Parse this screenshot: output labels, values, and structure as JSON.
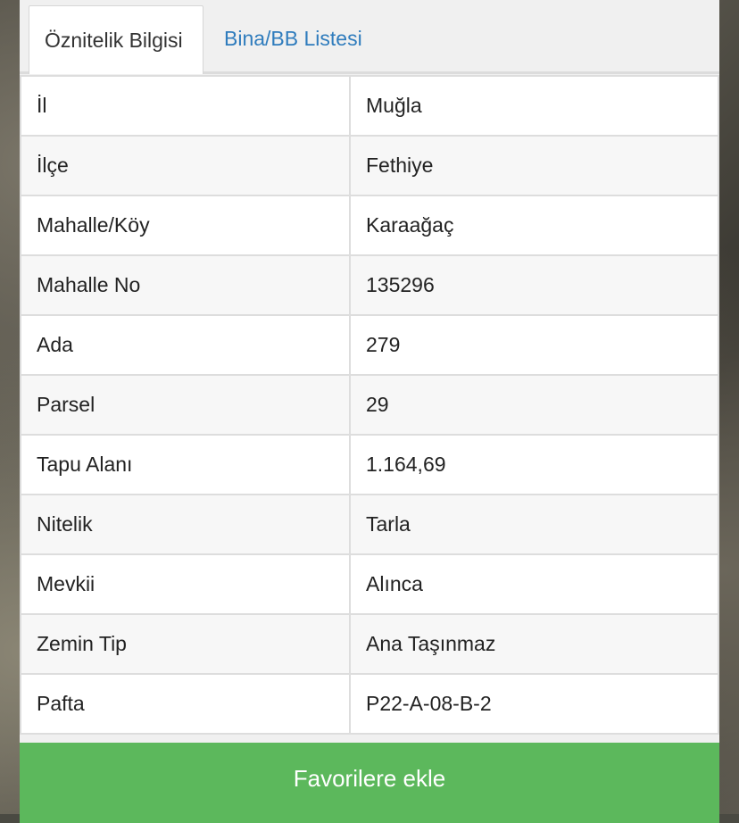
{
  "tabs": [
    {
      "label": "Öznitelik Bilgisi",
      "active": true
    },
    {
      "label": "Bina/BB Listesi",
      "active": false
    }
  ],
  "rows": [
    {
      "key": "İl",
      "value": "Muğla"
    },
    {
      "key": "İlçe",
      "value": "Fethiye"
    },
    {
      "key": "Mahalle/Köy",
      "value": "Karaağaç"
    },
    {
      "key": "Mahalle No",
      "value": "135296"
    },
    {
      "key": "Ada",
      "value": "279"
    },
    {
      "key": "Parsel",
      "value": "29"
    },
    {
      "key": "Tapu Alanı",
      "value": "1.164,69"
    },
    {
      "key": "Nitelik",
      "value": "Tarla"
    },
    {
      "key": "Mevkii",
      "value": "Alınca"
    },
    {
      "key": "Zemin Tip",
      "value": "Ana Taşınmaz"
    },
    {
      "key": "Pafta",
      "value": "P22-A-08-B-2"
    }
  ],
  "actions": {
    "favorite_label": "Favorilere ekle"
  },
  "colors": {
    "accent_green": "#5cb85c",
    "link_blue": "#2f7cbd"
  }
}
